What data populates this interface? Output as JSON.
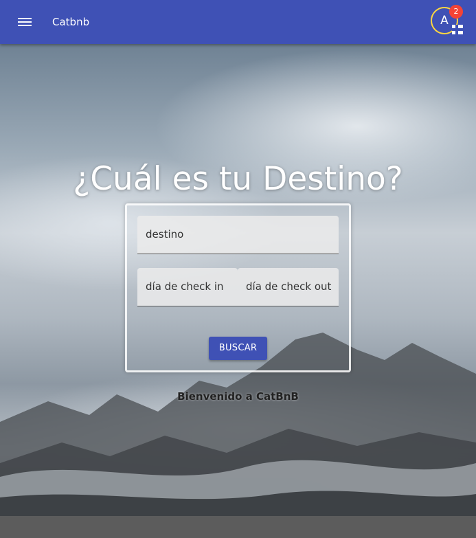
{
  "header": {
    "brand": "Catbnb",
    "avatar_initial": "A",
    "notification_count": "2",
    "menu_icon": "menu-icon",
    "flag_icon": "flag-icon",
    "bar_color": "#3f51b5"
  },
  "hero": {
    "headline": "¿Cuál es tu Destino?",
    "fields": {
      "destino_placeholder": "destino",
      "checkin_placeholder": "día de check in",
      "checkout_placeholder": "día de check out"
    },
    "search_button_label": "BUSCAR",
    "welcome_text": "Bienvenido a CatBnB"
  },
  "colors": {
    "accent": "#3f51b5",
    "avatar_ring": "#ffd740",
    "badge": "#f44336"
  }
}
